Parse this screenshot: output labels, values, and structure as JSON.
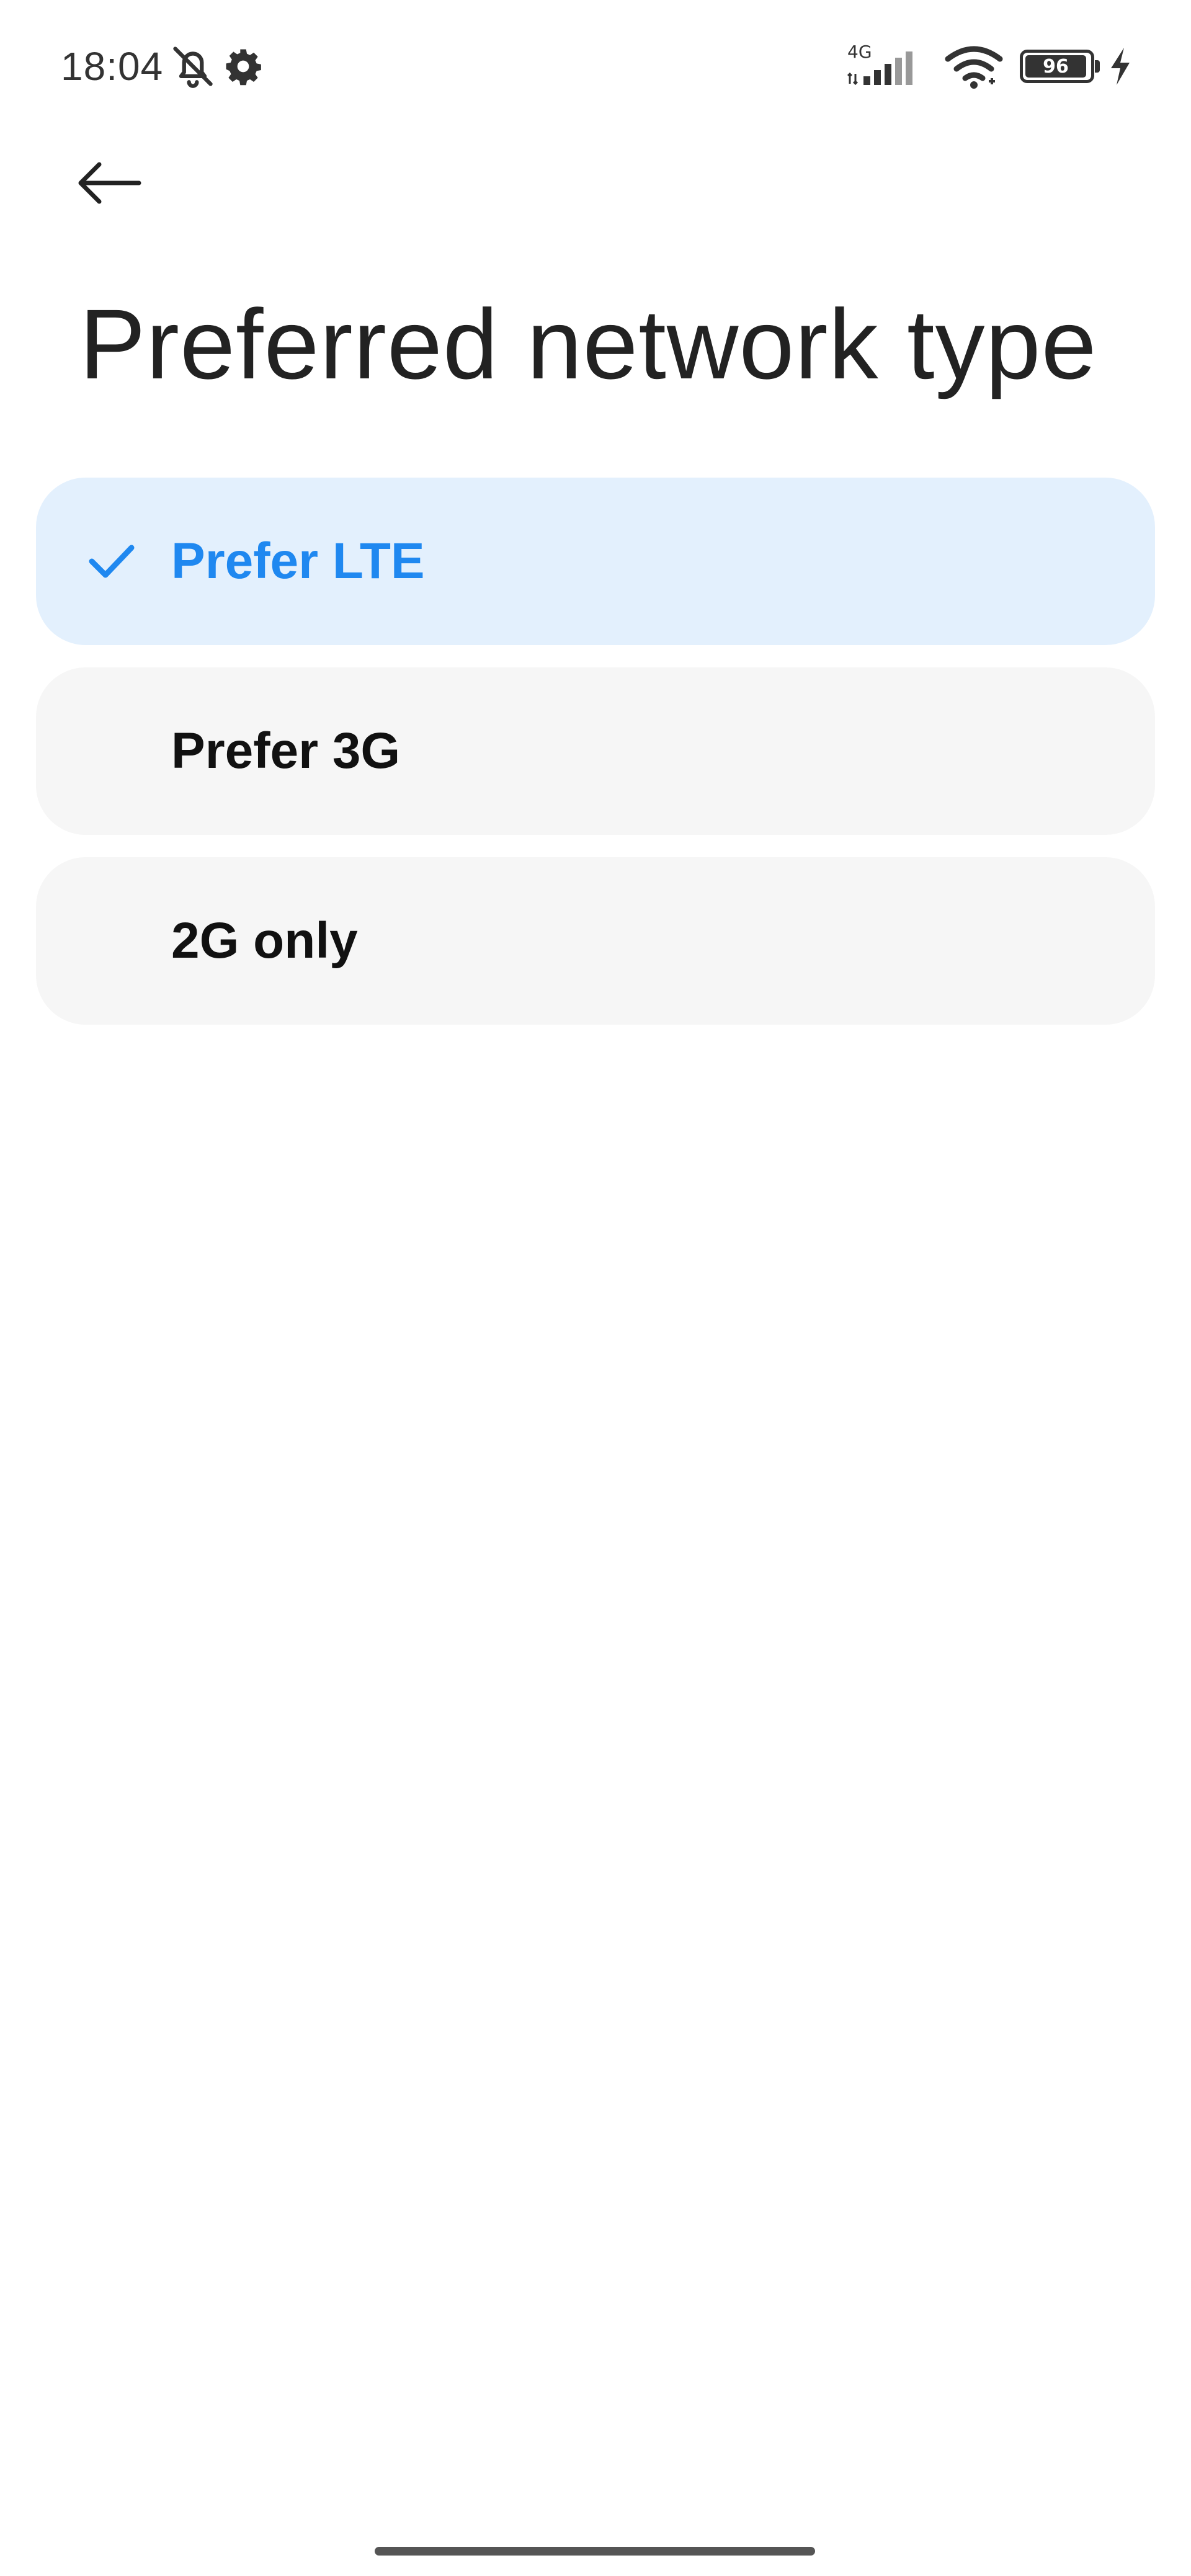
{
  "status_bar": {
    "time": "18:04",
    "network_type": "4G",
    "battery_level": "96",
    "battery_fraction": 0.96,
    "icons": [
      "bell-off-icon",
      "settings-gear-icon",
      "signal-icon",
      "wifi-icon",
      "battery-icon",
      "charging-bolt-icon"
    ]
  },
  "header": {
    "back_icon": "arrow-left-icon",
    "title": "Preferred network type"
  },
  "options": [
    {
      "label": "Prefer LTE",
      "selected": true
    },
    {
      "label": "Prefer 3G",
      "selected": false
    },
    {
      "label": "2G only",
      "selected": false
    }
  ],
  "colors": {
    "accent": "#1f88f0",
    "selected_background": "#e3f0fd",
    "option_background": "#f6f6f6"
  }
}
